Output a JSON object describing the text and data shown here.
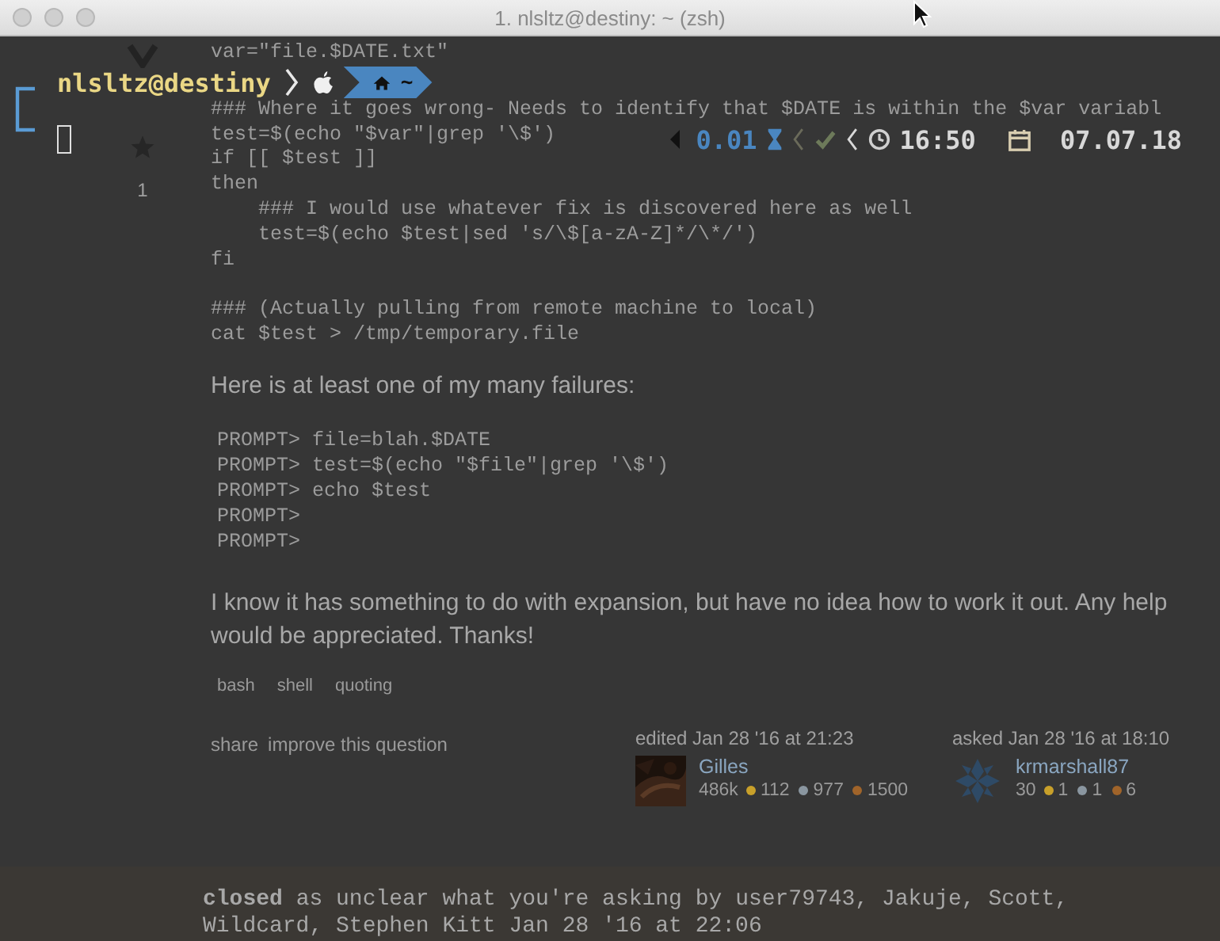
{
  "window": {
    "title": "1. nlsltz@destiny: ~ (zsh)"
  },
  "prompt": {
    "user_host": "nlsltz@destiny",
    "directory": "~"
  },
  "right_prompt": {
    "load": "0.01",
    "time": "16:50",
    "date": "07.07.18"
  },
  "question": {
    "favorites": "1",
    "code": [
      "var=\"file.$DATE.txt\"",
      "### Where it goes wrong- Needs to identify that $DATE is within the $var variabl",
      "test=$(echo \"$var\"|grep '\\$')",
      "if [[ $test ]]",
      "then",
      "    ### I would use whatever fix is discovered here as well",
      "    test=$(echo $test|sed 's/\\$[a-zA-Z]*/\\*/')",
      "fi",
      "### (Actually pulling from remote machine to local)",
      "cat $test > /tmp/temporary.file"
    ],
    "intro": "Here is at least one of my many failures:",
    "failures": [
      "PROMPT> file=blah.$DATE",
      "PROMPT> test=$(echo \"$file\"|grep '\\$')",
      "PROMPT> echo $test",
      "PROMPT>",
      "PROMPT>"
    ],
    "paragraph": "I know it has something to do with expansion, but have no idea how to work it out. Any help would be appreciated. Thanks!",
    "tags": [
      "bash",
      "shell",
      "quoting"
    ],
    "actions": [
      "share",
      "improve this question"
    ],
    "signatures": [
      {
        "action": "edited Jan 28 '16 at 21:23",
        "name": "Gilles",
        "reputation": "486k",
        "badges": [
          {
            "count": "112",
            "color": "#c8a02a"
          },
          {
            "count": "977",
            "color": "#8a96a0"
          },
          {
            "count": "1500",
            "color": "#a0642a"
          }
        ]
      },
      {
        "action": "asked Jan 28 '16 at 18:10",
        "name": "krmarshall87",
        "reputation": "30",
        "badges": [
          {
            "count": "1",
            "color": "#c8a02a"
          },
          {
            "count": "1",
            "color": "#8a96a0"
          },
          {
            "count": "6",
            "color": "#a0642a"
          }
        ]
      }
    ]
  },
  "closed_notice": "**closed** as unclear what you're asking by user79743, Jakuje, Scott, Wildcard, Stephen Kitt Jan 28 '16 at 22:06"
}
